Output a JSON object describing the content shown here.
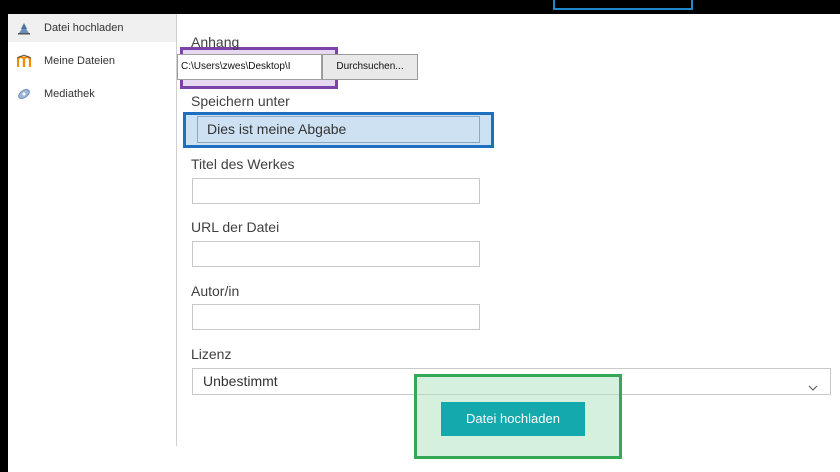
{
  "sidebar": {
    "items": [
      {
        "label": "Datei hochladen",
        "icon": "upload-icon",
        "active": true
      },
      {
        "label": "Meine Dateien",
        "icon": "moodle-icon",
        "active": false
      },
      {
        "label": "Mediathek",
        "icon": "media-library-icon",
        "active": false
      }
    ]
  },
  "form": {
    "attachment_label": "Anhang",
    "file_path": "C:\\Users\\zwes\\Desktop\\I",
    "browse_label": "Durchsuchen...",
    "save_as_label": "Speichern unter",
    "save_as_value": "Dies ist meine Abgabe",
    "title_label": "Titel des Werkes",
    "title_value": "",
    "url_label": "URL der Datei",
    "url_value": "",
    "author_label": "Autor/in",
    "author_value": "",
    "license_label": "Lizenz",
    "license_value": "Unbestimmt",
    "submit_label": "Datei hochladen"
  },
  "colors": {
    "accent": "#13a9ad",
    "highlight_purple": "#7b43a8",
    "highlight_blue": "#1e6fbf",
    "highlight_green": "#35a855"
  }
}
